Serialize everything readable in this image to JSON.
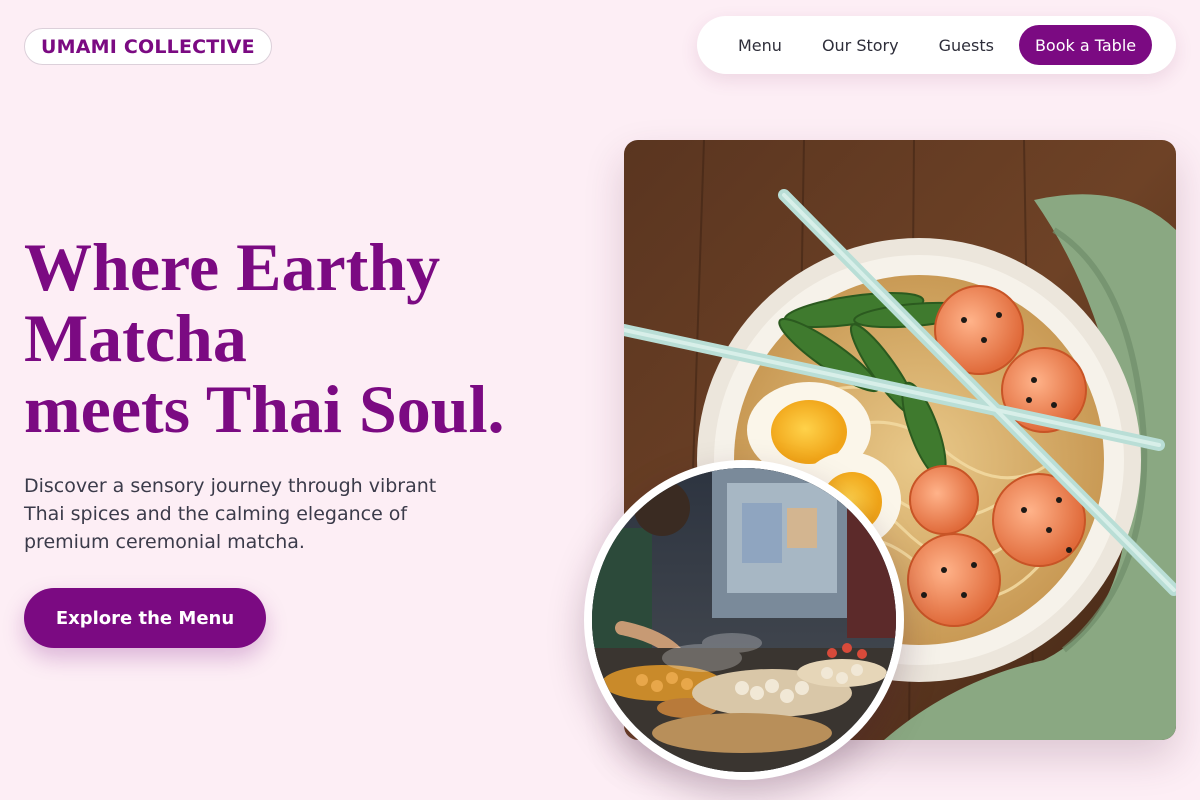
{
  "brand": {
    "name": "UMAMI COLLECTIVE"
  },
  "nav": {
    "links": [
      "Menu",
      "Our Story",
      "Guests"
    ],
    "cta_label": "Book a Table"
  },
  "hero": {
    "headline_lines": [
      "Where Earthy",
      "Matcha",
      "meets Thai Soul."
    ],
    "subcopy_lines": [
      "Discover a sensory journey through vibrant",
      "Thai spices and the calming elegance of",
      "premium ceremonial matcha."
    ],
    "cta_label": "Explore the Menu"
  },
  "images": {
    "main": {
      "subject": "noodle-soup-bowl-with-shrimp-egg-and-chopsticks"
    },
    "inset": {
      "subject": "night-market-street-food-stall"
    }
  },
  "colors": {
    "accent": "#7b0a82",
    "background": "#fdeef5",
    "text": "#3b3b4a"
  }
}
